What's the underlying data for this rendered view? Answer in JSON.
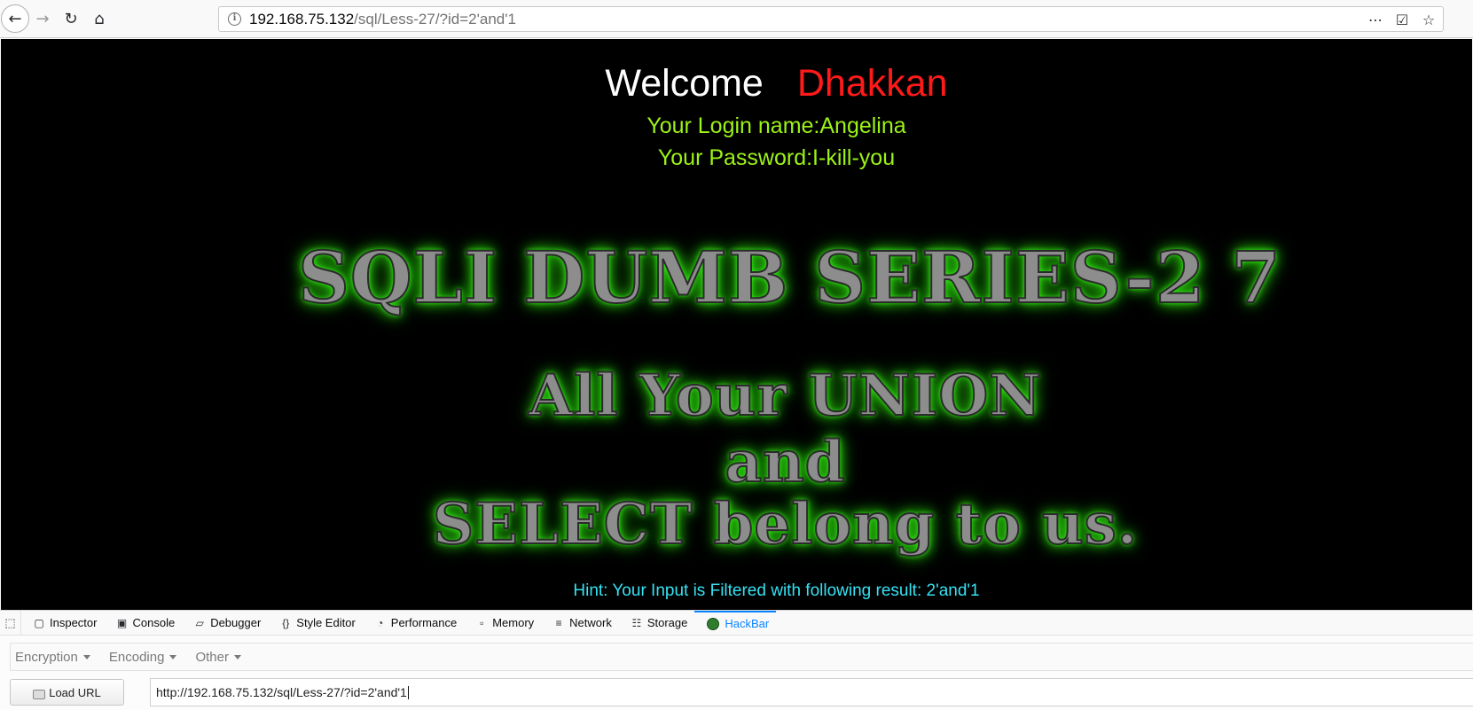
{
  "browser": {
    "url_host": "192.168.75.132",
    "url_path": "/sql/Less-27/?id=2'and'1",
    "icons": {
      "back": "back-arrow-icon",
      "forward": "forward-arrow-icon",
      "reload": "reload-icon",
      "home": "home-icon",
      "info": "info-icon",
      "more": "more-dots-icon",
      "pocket": "pocket-icon",
      "bookmark": "bookmark-star-icon"
    }
  },
  "page": {
    "welcome": "Welcome",
    "name": "Dhakkan",
    "login_line": "Your Login name:Angelina",
    "password_line": "Your Password:I-kill-you",
    "banner_title": "SQLI DUMB SERIES-2 7",
    "banner_line1": "All Your UNION",
    "banner_line2": "and",
    "banner_line3": "SELECT belong to us.",
    "hint": "Hint: Your Input is Filtered with following result: 2'and'1",
    "colors": {
      "background": "#000000",
      "welcome": "#ffffff",
      "name": "#ff1a1a",
      "credentials": "#9cf316",
      "hint": "#36e2f3",
      "glow": "#3aff19"
    }
  },
  "devtools": {
    "tabs": [
      {
        "label": "Inspector",
        "icon": "inspector-icon"
      },
      {
        "label": "Console",
        "icon": "console-icon"
      },
      {
        "label": "Debugger",
        "icon": "debugger-icon"
      },
      {
        "label": "Style Editor",
        "icon": "style-editor-icon"
      },
      {
        "label": "Performance",
        "icon": "performance-icon"
      },
      {
        "label": "Memory",
        "icon": "memory-icon"
      },
      {
        "label": "Network",
        "icon": "network-icon"
      },
      {
        "label": "Storage",
        "icon": "storage-icon"
      },
      {
        "label": "HackBar",
        "icon": "hackbar-icon",
        "active": true
      }
    ],
    "hackbar": {
      "menu": [
        "Encryption",
        "Encoding",
        "Other"
      ],
      "load_url_label": "Load URL",
      "url_value": "http://192.168.75.132/sql/Less-27/?id=2'and'1"
    }
  }
}
